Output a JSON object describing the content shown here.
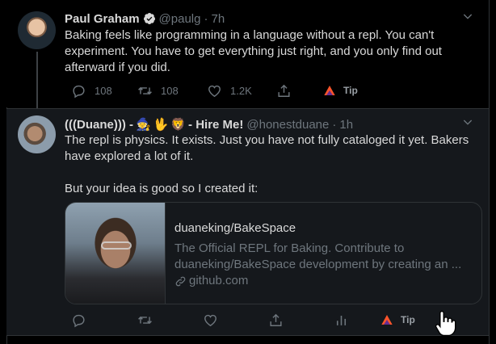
{
  "tweets": [
    {
      "author_name": "Paul Graham",
      "handle": "@paulg",
      "separator": "·",
      "time": "7h",
      "text_lines": [
        "Baking feels like programming in a language without a repl. You can't",
        "experiment. You have to get everything just right, and you only find out",
        "afterward if you did."
      ],
      "actions": {
        "reply_count": "108",
        "retweet_count": "108",
        "like_count": "1.2K",
        "tip_label": "Tip"
      }
    },
    {
      "author_name_prefix": "(((Duane))) -",
      "author_emojis": [
        "🧙",
        "🖖",
        "🦁"
      ],
      "author_name_suffix": "- Hire Me!",
      "handle": "@honestduane",
      "separator": "·",
      "time": "1h",
      "text_lines": [
        "The repl is physics.  It exists.  Just you have not fully cataloged it yet. Bakers",
        "have explored a lot of it.",
        "",
        "But your idea is good so I created it:"
      ],
      "card": {
        "title": "duaneking/BakeSpace",
        "description_lines": [
          "The Official REPL for Baking. Contribute to",
          "duaneking/BakeSpace development by creating an ..."
        ],
        "domain": "github.com"
      },
      "actions": {
        "tip_label": "Tip"
      }
    }
  ],
  "colors": {
    "background": "#000000",
    "reply_background": "#15181c",
    "border": "#2f3336",
    "text": "#d9d9d9",
    "muted": "#6e767d",
    "verified": "#d9d9d9",
    "brave_orange": "#fb542b",
    "brave_purple": "#662d91"
  },
  "icons": [
    "verified-badge-icon",
    "chevron-down-icon",
    "reply-icon",
    "retweet-icon",
    "like-icon",
    "share-icon",
    "analytics-icon",
    "brave-tip-icon",
    "link-icon",
    "hand-cursor-icon"
  ]
}
